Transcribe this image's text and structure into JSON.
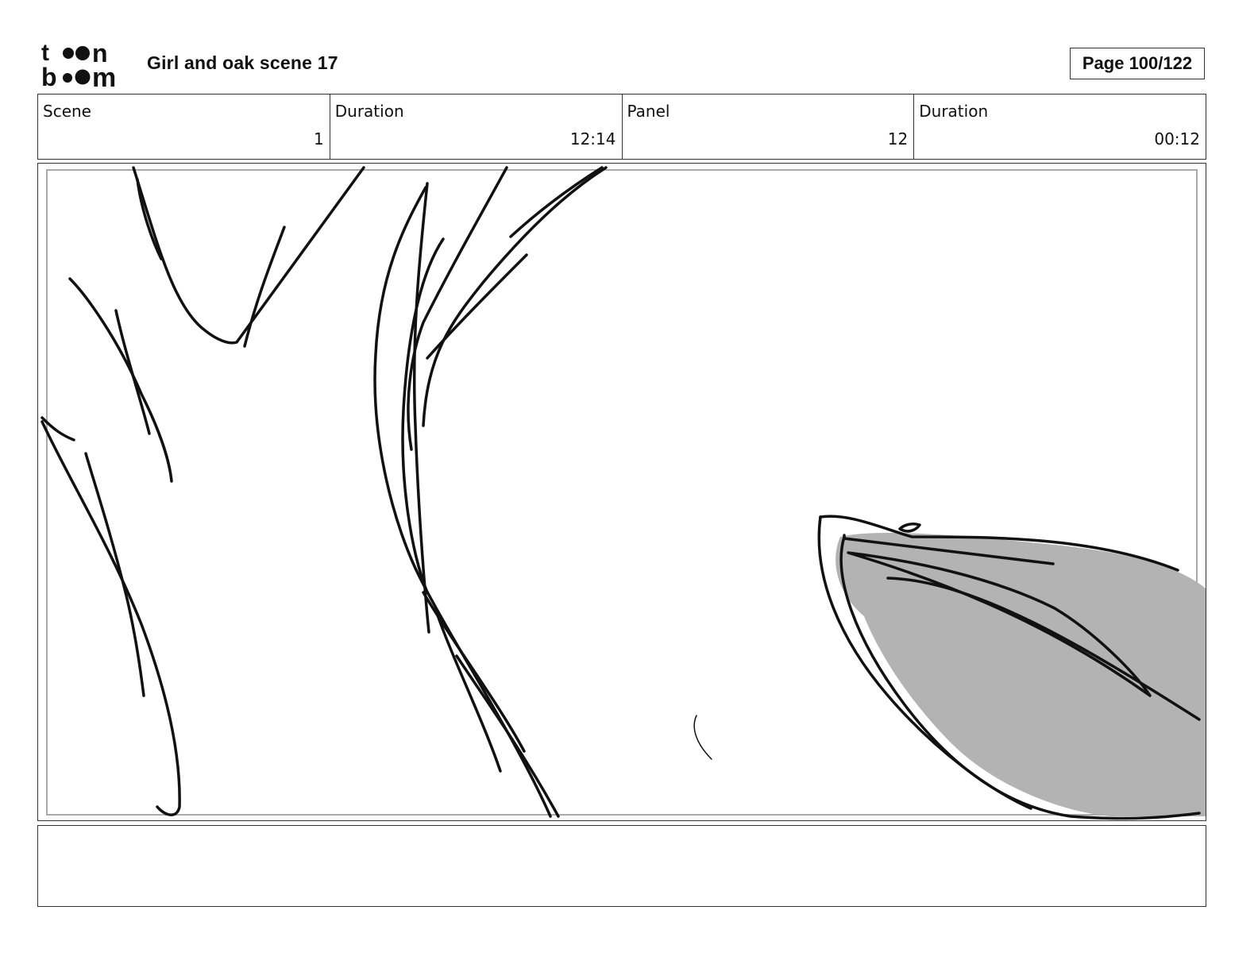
{
  "header": {
    "logo_text": "toon boom",
    "title": "Girl and oak scene 17",
    "page_label": "Page 100/122"
  },
  "info": [
    {
      "label": "Scene",
      "value": "1"
    },
    {
      "label": "Duration",
      "value": "12:14"
    },
    {
      "label": "Panel",
      "value": "12"
    },
    {
      "label": "Duration",
      "value": "00:12"
    }
  ],
  "panel": {
    "description": "",
    "fill_color": "#b3b3b3",
    "line_color": "#111111"
  },
  "notes": {
    "text": ""
  }
}
